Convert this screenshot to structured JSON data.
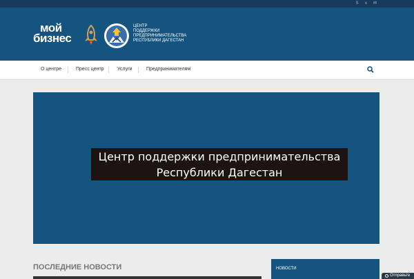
{
  "social": [
    {
      "icon": "skype-icon",
      "glyph": "S"
    },
    {
      "icon": "vimeo-icon",
      "glyph": "v"
    },
    {
      "icon": "mail-icon",
      "glyph": "✉"
    }
  ],
  "brand": {
    "logo_line1": "мой",
    "logo_line2": "бизнес",
    "center_name": [
      "Центр",
      "поддержки",
      "предпринимательства",
      "Республики Дагестан"
    ]
  },
  "nav": {
    "items": [
      "О центре",
      "Пресс центр",
      "Услуги",
      "Предпринимателям"
    ]
  },
  "hero": {
    "title_line1": "Центр поддержки предпринимательства",
    "title_line2": "Республики Дагестан"
  },
  "news": {
    "title": "ПОСЛЕДНИЕ НОВОСТИ"
  },
  "sidebar": {
    "label": "НОВОСТИ"
  },
  "send_button": {
    "label": "Отправьте"
  },
  "colors": {
    "brand_blue": "#165480",
    "topbar": "#163a5a",
    "hero_caption_bg": "#1b1412"
  }
}
